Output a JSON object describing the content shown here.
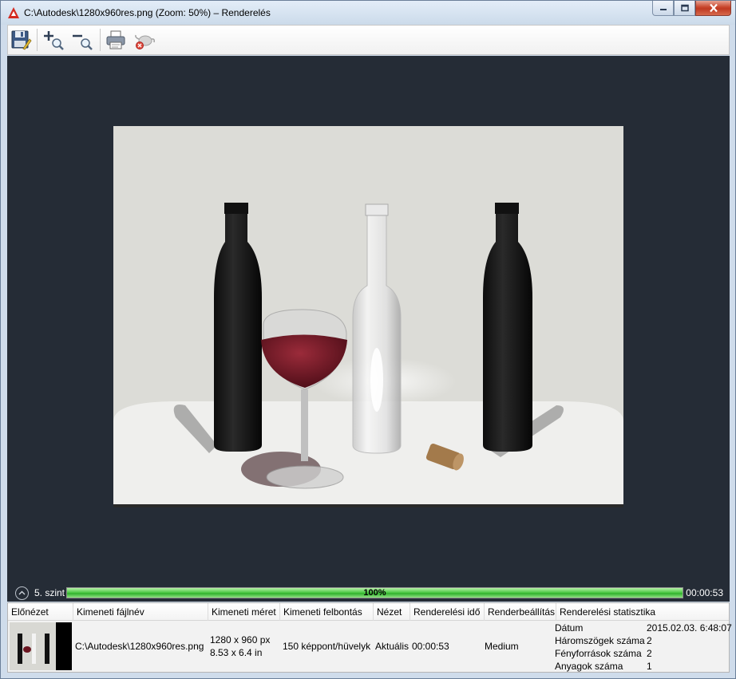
{
  "window": {
    "title": "C:\\Autodesk\\1280x960res.png (Zoom: 50%) – Renderelés"
  },
  "toolbar": {
    "buttons": [
      {
        "name": "save-icon"
      },
      {
        "name": "zoom-in-icon"
      },
      {
        "name": "zoom-out-icon"
      },
      {
        "name": "print-icon"
      },
      {
        "name": "cancel-render-icon"
      }
    ]
  },
  "status": {
    "level": "5. szint",
    "progress_percent": 100,
    "progress_label": "100%",
    "elapsed": "00:00:53"
  },
  "history": {
    "columns": [
      "Előnézet",
      "Kimeneti fájlnév",
      "Kimeneti méret",
      "Kimeneti felbontás",
      "Nézet",
      "Renderelési idő",
      "Renderbeállítás",
      "Renderelési statisztika"
    ],
    "row": {
      "filename": "C:\\Autodesk\\1280x960res.png",
      "size_px": "1280 x 960 px",
      "size_in": "8.53 x 6.4 in",
      "resolution": "150 képpont/hüvelyk",
      "view": "Aktuális",
      "render_time": "00:00:53",
      "preset": "Medium",
      "stats": [
        {
          "key": "Dátum",
          "value": "2015.02.03. 6:48:07"
        },
        {
          "key": "Háromszögek száma",
          "value": "2"
        },
        {
          "key": "Fényforrások száma",
          "value": "2"
        },
        {
          "key": "Anyagok száma",
          "value": "1"
        }
      ]
    }
  },
  "colors": {
    "viewport_bg": "#252c36",
    "progress_green": "#47c640",
    "app_red": "#d42a20"
  }
}
